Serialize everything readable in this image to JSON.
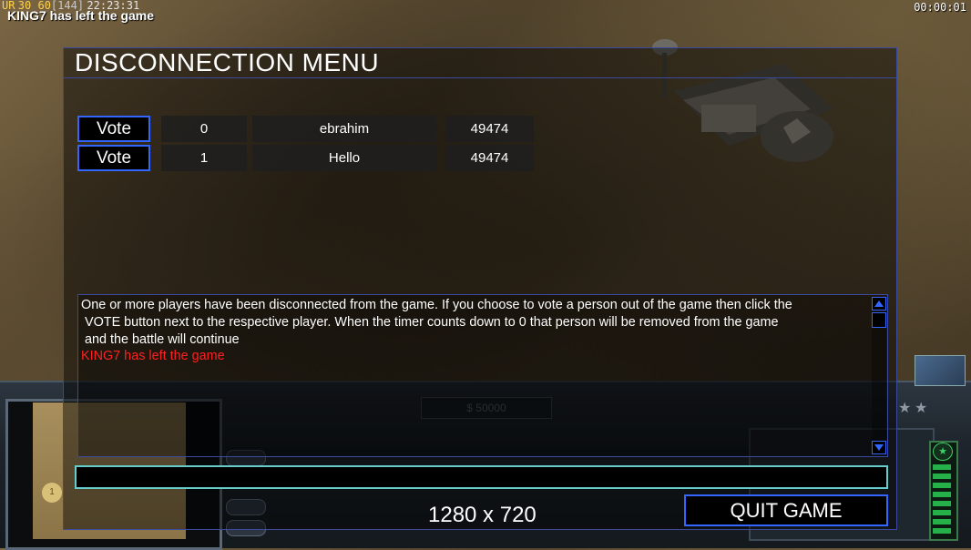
{
  "hud": {
    "ur_label": "UR",
    "fps_values": "30 60",
    "ping": "[144]",
    "clock": "22:23:31",
    "message": "KING7 has left the game",
    "timer": "00:00:01"
  },
  "game_hud": {
    "money": "$ 50000"
  },
  "dialog": {
    "title": "DISCONNECTION MENU",
    "players": [
      {
        "vote_label": "Vote",
        "slot": "0",
        "name": "ebrahim",
        "ping": "49474"
      },
      {
        "vote_label": "Vote",
        "slot": "1",
        "name": "Hello",
        "ping": "49474"
      }
    ],
    "chat_lines": [
      "One or more players have been disconnected from the game. If you choose to vote a person out of the game then click the",
      " VOTE button next to the respective player. When the timer counts down to 0 that person will be removed from the game",
      " and the battle will continue"
    ],
    "chat_alert": "KING7 has left the game",
    "chat_input_value": "",
    "resolution": "1280 x 720",
    "quit_label": "QUIT GAME"
  },
  "colors": {
    "accent_blue": "#3366ff",
    "input_cyan": "#66cccc",
    "alert_red": "#ff2020",
    "hud_yellow": "#ffd24a"
  }
}
